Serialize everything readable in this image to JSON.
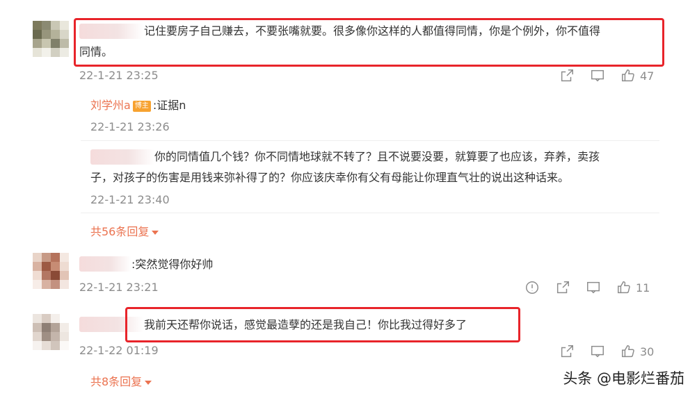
{
  "comments": [
    {
      "text_line1": "记住要房子自己赚去，不要张嘴就要。很多像你这样的人都值得同情，你是个例外，你不值得",
      "text_line2": "同情。",
      "time": "22-1-21 23:25",
      "likes": "47",
      "replies": [
        {
          "user": "刘学州a",
          "badge": "博主",
          "text": ":证据n",
          "time": "22-1-21 23:26"
        },
        {
          "text_line1": "你的同情值几个钱？你不同情地球就不转了？且不说要没要，就算要了也应该，弃养，卖孩",
          "text_line2": "子，对孩子的伤害是用钱来弥补得了的？你应该庆幸你有父有母能让你理直气壮的说出这种话来。",
          "time": "22-1-21 23:40"
        }
      ],
      "more_replies": "共56条回复"
    },
    {
      "text": ":突然觉得你好帅",
      "time": "22-1-21 23:21",
      "likes": "11"
    },
    {
      "text": "我前天还帮你说话，感觉最造孽的还是我自己！你比我过得好多了",
      "time": "22-1-22 01:19",
      "likes": "30",
      "more_replies": "共8条回复"
    }
  ],
  "watermark": "头条 @电影烂番茄",
  "icons": {
    "share": "share-icon",
    "comment": "comment-icon",
    "like": "thumbs-up-icon",
    "report": "report-icon"
  },
  "colors": {
    "accent": "#eb7350",
    "highlight_box": "#e8242a",
    "meta": "#8c8c8c"
  }
}
